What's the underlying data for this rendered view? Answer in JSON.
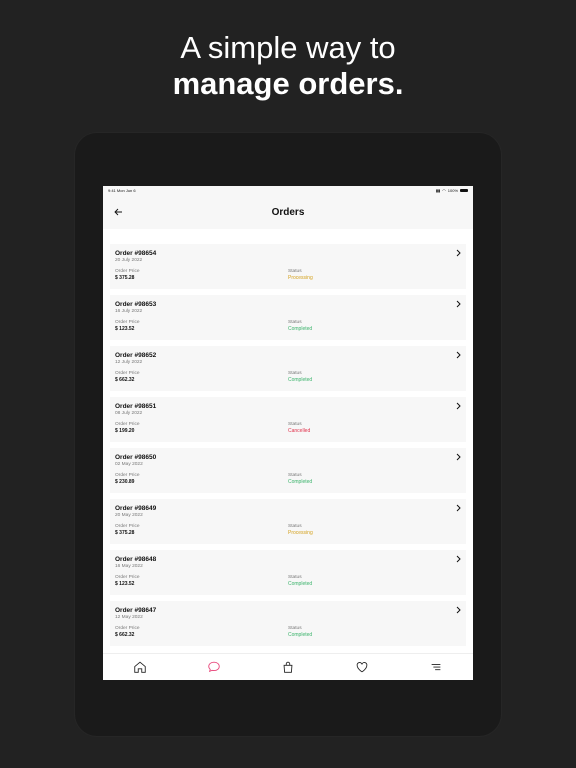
{
  "headline": {
    "line1": "A simple way to",
    "line2": "manage orders."
  },
  "statusbar": {
    "time": "9:41",
    "date": "Mon Jun 6",
    "battery": "100%"
  },
  "navbar": {
    "title": "Orders",
    "back_icon": "arrow-left-icon"
  },
  "colors": {
    "processing": "#d4a21f",
    "completed": "#3bb36b",
    "cancelled": "#e0314b",
    "active_tab": "#e8457a"
  },
  "orders": [
    {
      "id": "Order #98654",
      "date": "20 July 2022",
      "price_label": "Order Price",
      "price": "$ 375.28",
      "status_label": "Status",
      "status": "Processing"
    },
    {
      "id": "Order #98653",
      "date": "16 July 2022",
      "price_label": "Order Price",
      "price": "$ 123.52",
      "status_label": "Status",
      "status": "Completed"
    },
    {
      "id": "Order #98652",
      "date": "12 July 2022",
      "price_label": "Order Price",
      "price": "$ 662.32",
      "status_label": "Status",
      "status": "Completed"
    },
    {
      "id": "Order #98651",
      "date": "08 July 2022",
      "price_label": "Order Price",
      "price": "$ 199.20",
      "status_label": "Status",
      "status": "Cancelled"
    },
    {
      "id": "Order #98650",
      "date": "02 May 2022",
      "price_label": "Order Price",
      "price": "$ 230.89",
      "status_label": "Status",
      "status": "Completed"
    },
    {
      "id": "Order #98649",
      "date": "20 May 2022",
      "price_label": "Order Price",
      "price": "$ 375.28",
      "status_label": "Status",
      "status": "Processing"
    },
    {
      "id": "Order #98648",
      "date": "16 May 2022",
      "price_label": "Order Price",
      "price": "$ 123.52",
      "status_label": "Status",
      "status": "Completed"
    },
    {
      "id": "Order #98647",
      "date": "12 May 2022",
      "price_label": "Order Price",
      "price": "$ 662.32",
      "status_label": "Status",
      "status": "Completed"
    }
  ],
  "tabbar": {
    "items": [
      {
        "icon": "home-icon",
        "active": false
      },
      {
        "icon": "chat-bubble-icon",
        "active": true
      },
      {
        "icon": "shopping-bag-icon",
        "active": false
      },
      {
        "icon": "heart-icon",
        "active": false
      },
      {
        "icon": "menu-icon",
        "active": false
      }
    ]
  }
}
